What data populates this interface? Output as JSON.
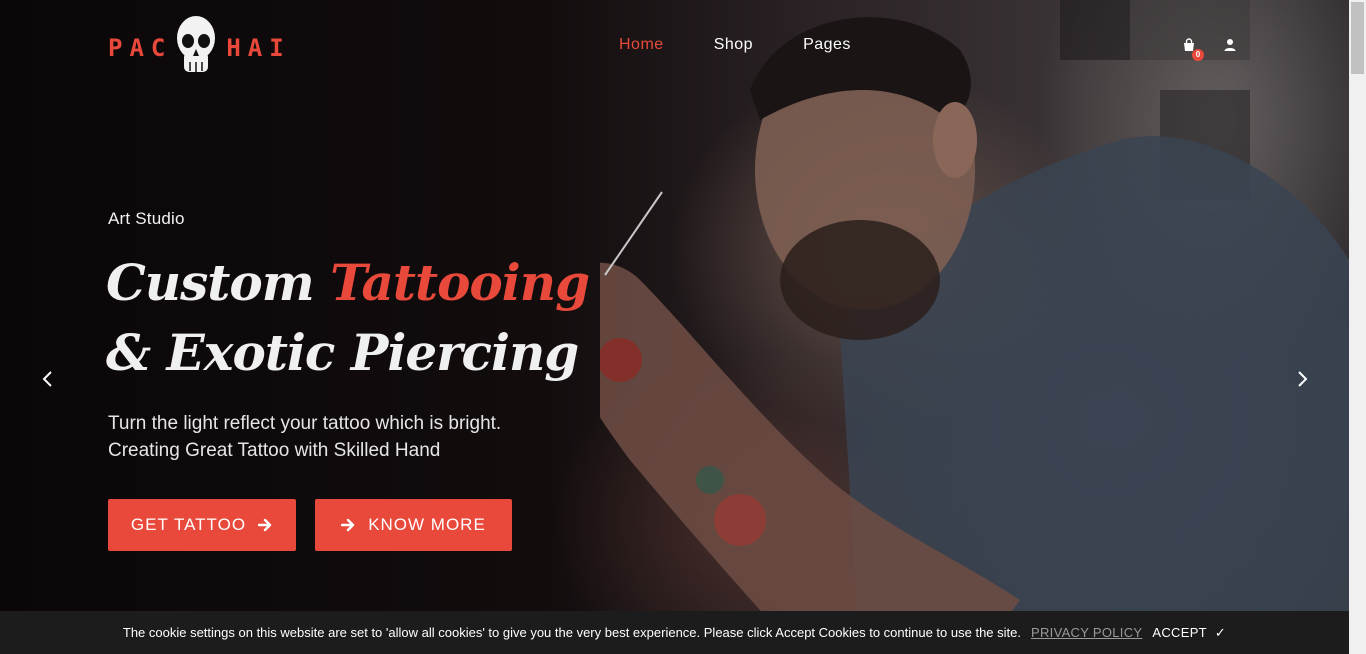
{
  "brand": {
    "left": "PAC",
    "right": "HAI",
    "accent_color": "#e8493a"
  },
  "nav": {
    "items": [
      {
        "label": "Home",
        "active": true
      },
      {
        "label": "Shop",
        "active": false
      },
      {
        "label": "Pages",
        "active": false
      }
    ]
  },
  "header_icons": {
    "cart_icon": "shopping-bag-icon",
    "cart_count": "0",
    "user_icon": "user-icon"
  },
  "hero": {
    "eyebrow": "Art Studio",
    "headline_part1": "Custom ",
    "headline_accent": "Tattooing",
    "headline_part2": " & Exotic Piercing",
    "subtext_line1": "Turn the light reflect your tattoo which is bright.",
    "subtext_line2": "Creating Great Tattoo with Skilled Hand",
    "primary_button": "GET TATTOO",
    "secondary_button": "KNOW MORE"
  },
  "slider": {
    "prev_icon": "chevron-left-icon",
    "next_icon": "chevron-right-icon"
  },
  "cookie": {
    "text": "The cookie settings on this website are set to 'allow all cookies' to give you the very best experience. Please click Accept Cookies to continue to use the site.",
    "privacy_label": "PRIVACY POLICY",
    "accept_label": "ACCEPT",
    "accept_mark": "✓"
  }
}
